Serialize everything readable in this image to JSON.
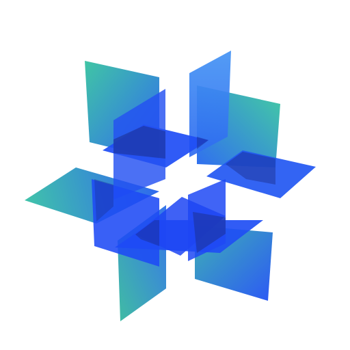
{
  "canvas": {
    "background": "#ffffff"
  },
  "artwork": {
    "icon": "3d-plane-lattice-icon",
    "description_visible_text": "",
    "colors": {
      "teal": "#36C2A0",
      "blue": "#2462F0",
      "light_blue": "#3C8BF2",
      "deep_blue": "#1C44F5",
      "shade": "#1B2D8A"
    }
  }
}
